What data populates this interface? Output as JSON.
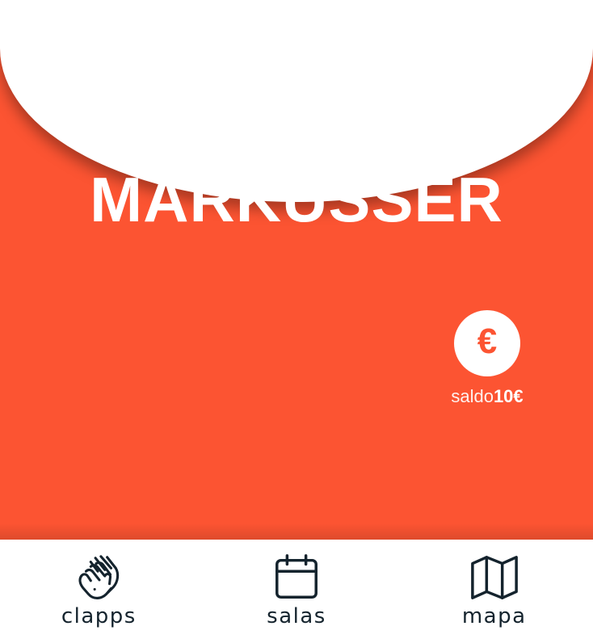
{
  "profile": {
    "username": "MARKUSSER"
  },
  "balance": {
    "icon": "euro-icon",
    "icon_glyph": "€",
    "label": "saldo",
    "amount": "10€"
  },
  "nav": {
    "items": [
      {
        "label": "clapps",
        "icon": "clapping-hands-icon"
      },
      {
        "label": "salas",
        "icon": "calendar-icon"
      },
      {
        "label": "mapa",
        "icon": "map-icon"
      }
    ]
  },
  "colors": {
    "brand_orange": "#FC5432",
    "nav_text": "#14232D",
    "background": "#FFFFFF"
  }
}
